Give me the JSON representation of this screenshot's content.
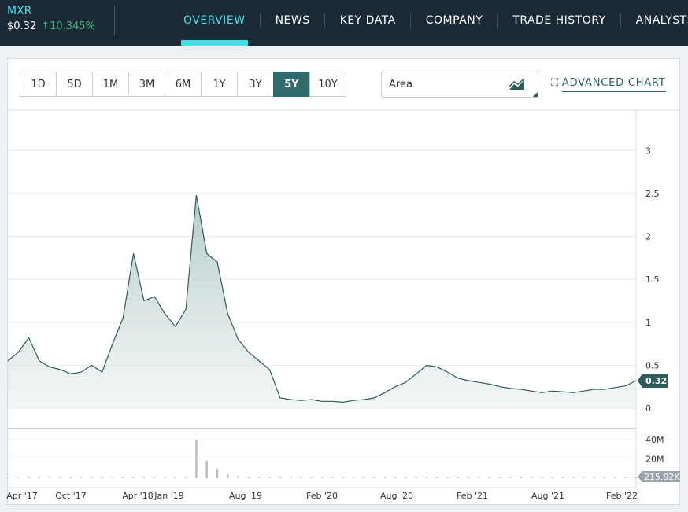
{
  "header": {
    "ticker": "MXR",
    "price": "$0.32",
    "change_arrow": "↑",
    "change_pct": "10.345%",
    "nav": [
      {
        "label": "OVERVIEW",
        "active": true
      },
      {
        "label": "NEWS",
        "active": false
      },
      {
        "label": "KEY DATA",
        "active": false
      },
      {
        "label": "COMPANY",
        "active": false
      },
      {
        "label": "TRADE HISTORY",
        "active": false
      },
      {
        "label": "ANALYSTS",
        "active": false
      }
    ]
  },
  "toolbar": {
    "ranges": [
      "1D",
      "5D",
      "1M",
      "3M",
      "6M",
      "1Y",
      "3Y",
      "5Y",
      "10Y"
    ],
    "active_range": "5Y",
    "chart_type": "Area",
    "advanced_label": "ADVANCED CHART"
  },
  "colors": {
    "accent": "#3fe0e6",
    "line": "#2e5c5a",
    "active_button": "#2e6b6a",
    "positive": "#35b97a"
  },
  "chart_data": [
    {
      "type": "area",
      "x_ticks": [
        "Apr '17",
        "Oct '17",
        "Apr '18",
        "Jan '19",
        "Aug '19",
        "Feb '20",
        "Aug '20",
        "Feb '21",
        "Aug '21",
        "Feb '22"
      ],
      "y_ticks": [
        "0",
        "0.5",
        "1",
        "1.5",
        "2",
        "2.5",
        "3"
      ],
      "ylim": [
        0,
        3.3
      ],
      "last_value_label": "0.32",
      "x": [
        "2017-03",
        "2017-04",
        "2017-05",
        "2017-06",
        "2017-07",
        "2017-08",
        "2017-09",
        "2017-10",
        "2017-11",
        "2017-12",
        "2018-01",
        "2018-02",
        "2018-03",
        "2018-04",
        "2018-05",
        "2018-06",
        "2018-07",
        "2018-08",
        "2018-09",
        "2018-10",
        "2018-11",
        "2018-12",
        "2019-01",
        "2019-02",
        "2019-03",
        "2019-04",
        "2019-05",
        "2019-06",
        "2019-07",
        "2019-08",
        "2019-09",
        "2019-10",
        "2019-11",
        "2019-12",
        "2020-01",
        "2020-02",
        "2020-03",
        "2020-04",
        "2020-05",
        "2020-06",
        "2020-07",
        "2020-08",
        "2020-09",
        "2020-10",
        "2020-11",
        "2020-12",
        "2021-01",
        "2021-02",
        "2021-03",
        "2021-04",
        "2021-05",
        "2021-06",
        "2021-07",
        "2021-08",
        "2021-09",
        "2021-10",
        "2021-11",
        "2021-12",
        "2022-01",
        "2022-02",
        "2022-03"
      ],
      "values": [
        0.55,
        0.65,
        0.82,
        0.55,
        0.48,
        0.45,
        0.4,
        0.42,
        0.5,
        0.42,
        0.75,
        1.05,
        1.8,
        1.25,
        1.3,
        1.1,
        0.95,
        1.15,
        2.48,
        1.8,
        1.7,
        1.1,
        0.8,
        0.65,
        0.55,
        0.45,
        0.12,
        0.1,
        0.09,
        0.1,
        0.08,
        0.08,
        0.07,
        0.09,
        0.1,
        0.12,
        0.18,
        0.25,
        0.3,
        0.4,
        0.5,
        0.48,
        0.42,
        0.35,
        0.32,
        0.3,
        0.28,
        0.25,
        0.23,
        0.22,
        0.2,
        0.18,
        0.2,
        0.19,
        0.18,
        0.2,
        0.22,
        0.22,
        0.24,
        0.26,
        0.32
      ],
      "volume": {
        "y_ticks": [
          "20M",
          "40M"
        ],
        "last_value_label": "215.92K",
        "values_M": [
          0,
          0,
          0,
          0,
          0,
          0,
          0,
          0,
          0,
          0,
          0,
          0,
          0,
          0,
          0,
          0,
          0,
          0,
          40,
          18,
          10,
          4,
          2,
          1,
          1,
          1,
          0,
          0,
          0,
          0,
          0,
          0,
          0,
          0,
          0,
          0,
          0,
          0,
          1,
          1,
          1,
          1,
          1,
          1,
          1,
          1,
          1,
          1,
          1,
          1,
          1,
          1,
          1,
          1,
          1,
          1,
          1,
          1,
          1,
          1,
          1
        ]
      }
    }
  ]
}
